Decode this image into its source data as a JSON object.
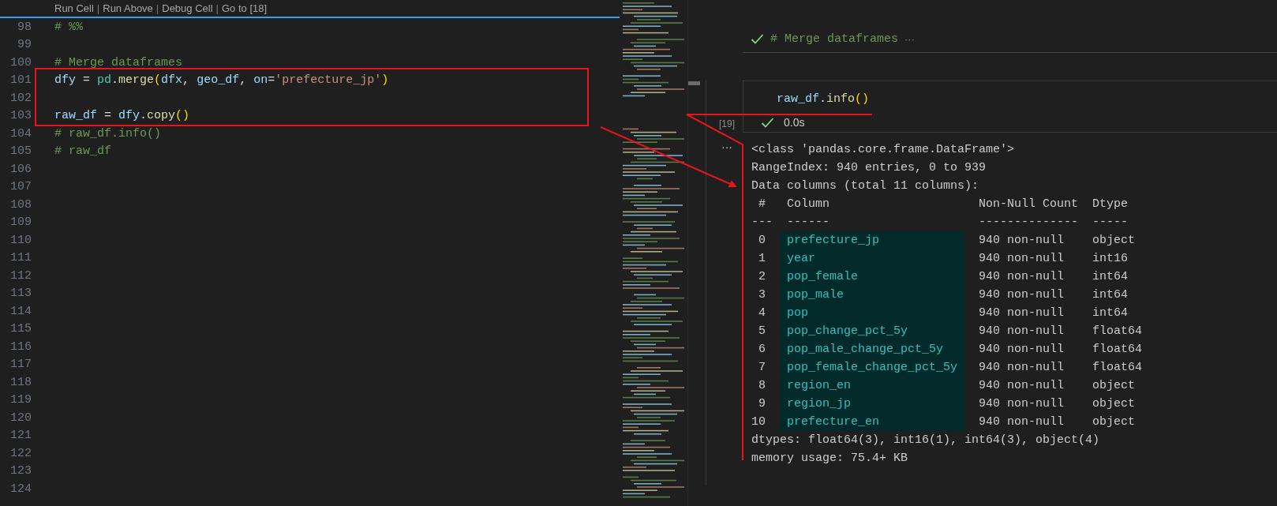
{
  "editor": {
    "codelens": [
      {
        "kind": "link",
        "text": "Run Cell"
      },
      {
        "kind": "separator",
        "text": "|"
      },
      {
        "kind": "link",
        "text": "Run Above"
      },
      {
        "kind": "separator",
        "text": "|"
      },
      {
        "kind": "link",
        "text": "Debug Cell"
      },
      {
        "kind": "separator",
        "text": "|"
      },
      {
        "kind": "link",
        "text": "Go to [18]"
      }
    ],
    "lines": [
      {
        "number": "98",
        "tokens": [
          {
            "kind": "comment",
            "text": "# %%"
          }
        ]
      },
      {
        "number": "99"
      },
      {
        "number": "100",
        "tokens": [
          {
            "kind": "comment",
            "text": "# Merge dataframes"
          }
        ]
      },
      {
        "number": "101",
        "tokens": [
          {
            "kind": "variable",
            "text": "dfy"
          },
          {
            "kind": "plain",
            "text": " = "
          },
          {
            "kind": "module",
            "text": "pd"
          },
          {
            "kind": "plain",
            "text": "."
          },
          {
            "kind": "function",
            "text": "merge"
          },
          {
            "kind": "bracket",
            "text": "("
          },
          {
            "kind": "variable",
            "text": "dfx"
          },
          {
            "kind": "plain",
            "text": ", "
          },
          {
            "kind": "variable",
            "text": "geo_df"
          },
          {
            "kind": "plain",
            "text": ", "
          },
          {
            "kind": "variable",
            "text": "on"
          },
          {
            "kind": "plain",
            "text": "="
          },
          {
            "kind": "string",
            "text": "'prefecture_jp'"
          },
          {
            "kind": "bracket",
            "text": ")"
          }
        ]
      },
      {
        "number": "102"
      },
      {
        "number": "103",
        "tokens": [
          {
            "kind": "variable",
            "text": "raw_df"
          },
          {
            "kind": "plain",
            "text": " = "
          },
          {
            "kind": "variable",
            "text": "dfy"
          },
          {
            "kind": "plain",
            "text": "."
          },
          {
            "kind": "function",
            "text": "copy"
          },
          {
            "kind": "bracket",
            "text": "()"
          }
        ]
      },
      {
        "number": "104",
        "tokens": [
          {
            "kind": "comment",
            "text": "# raw_df.info()"
          }
        ]
      },
      {
        "number": "105",
        "tokens": [
          {
            "kind": "comment",
            "text": "# raw_df"
          }
        ]
      },
      {
        "number": "106"
      },
      {
        "number": "107"
      },
      {
        "number": "108"
      },
      {
        "number": "109"
      },
      {
        "number": "110"
      },
      {
        "number": "111"
      },
      {
        "number": "112"
      },
      {
        "number": "113"
      },
      {
        "number": "114"
      },
      {
        "number": "115"
      },
      {
        "number": "116"
      },
      {
        "number": "117"
      },
      {
        "number": "118"
      },
      {
        "number": "119"
      },
      {
        "number": "120"
      },
      {
        "number": "121"
      },
      {
        "number": "122"
      },
      {
        "number": "123"
      },
      {
        "number": "124"
      }
    ]
  },
  "notebook": {
    "markdown_cell": {
      "succeeded": true,
      "text": "# Merge dataframes",
      "more": "···"
    },
    "code_cell": {
      "execution_count": "[19]",
      "tokens": [
        {
          "kind": "variable",
          "text": "raw_df"
        },
        {
          "kind": "plain",
          "text": "."
        },
        {
          "kind": "function",
          "text": "info"
        },
        {
          "kind": "bracket",
          "text": "()"
        }
      ],
      "succeeded": true,
      "duration": "0.0s"
    },
    "output": {
      "menu": "···",
      "lines": [
        {
          "kind": "text",
          "text": "<class 'pandas.core.frame.DataFrame'>"
        },
        {
          "kind": "text",
          "text": "RangeIndex: 940 entries, 0 to 939"
        },
        {
          "kind": "text",
          "text": "Data columns (total 11 columns):"
        },
        {
          "kind": "header",
          "cells": [
            "#",
            "Column",
            "Non-Null Count",
            "Dtype"
          ]
        },
        {
          "kind": "rule",
          "cells": [
            "---",
            "------",
            "--------------",
            "-----"
          ]
        },
        {
          "kind": "row",
          "highlighted": true,
          "cells": [
            "0",
            "prefecture_jp",
            "940 non-null",
            "object"
          ]
        },
        {
          "kind": "row",
          "highlighted": true,
          "cells": [
            "1",
            "year",
            "940 non-null",
            "int16"
          ]
        },
        {
          "kind": "row",
          "highlighted": true,
          "cells": [
            "2",
            "pop_female",
            "940 non-null",
            "int64"
          ]
        },
        {
          "kind": "row",
          "highlighted": true,
          "cells": [
            "3",
            "pop_male",
            "940 non-null",
            "int64"
          ]
        },
        {
          "kind": "row",
          "highlighted": true,
          "cells": [
            "4",
            "pop",
            "940 non-null",
            "int64"
          ]
        },
        {
          "kind": "row",
          "highlighted": true,
          "cells": [
            "5",
            "pop_change_pct_5y",
            "940 non-null",
            "float64"
          ]
        },
        {
          "kind": "row",
          "highlighted": true,
          "cells": [
            "6",
            "pop_male_change_pct_5y",
            "940 non-null",
            "float64"
          ]
        },
        {
          "kind": "row",
          "highlighted": true,
          "cells": [
            "7",
            "pop_female_change_pct_5y",
            "940 non-null",
            "float64"
          ]
        },
        {
          "kind": "row",
          "highlighted": true,
          "cells": [
            "8",
            "region_en",
            "940 non-null",
            "object"
          ]
        },
        {
          "kind": "row",
          "highlighted": true,
          "cells": [
            "9",
            "region_jp",
            "940 non-null",
            "object"
          ]
        },
        {
          "kind": "row",
          "highlighted": true,
          "cells": [
            "10",
            "prefecture_en",
            "940 non-null",
            "object"
          ]
        },
        {
          "kind": "text",
          "text": "dtypes: float64(3), int16(1), int64(3), object(4)"
        },
        {
          "kind": "text",
          "text": "memory usage: 75.4+ KB"
        }
      ]
    }
  }
}
